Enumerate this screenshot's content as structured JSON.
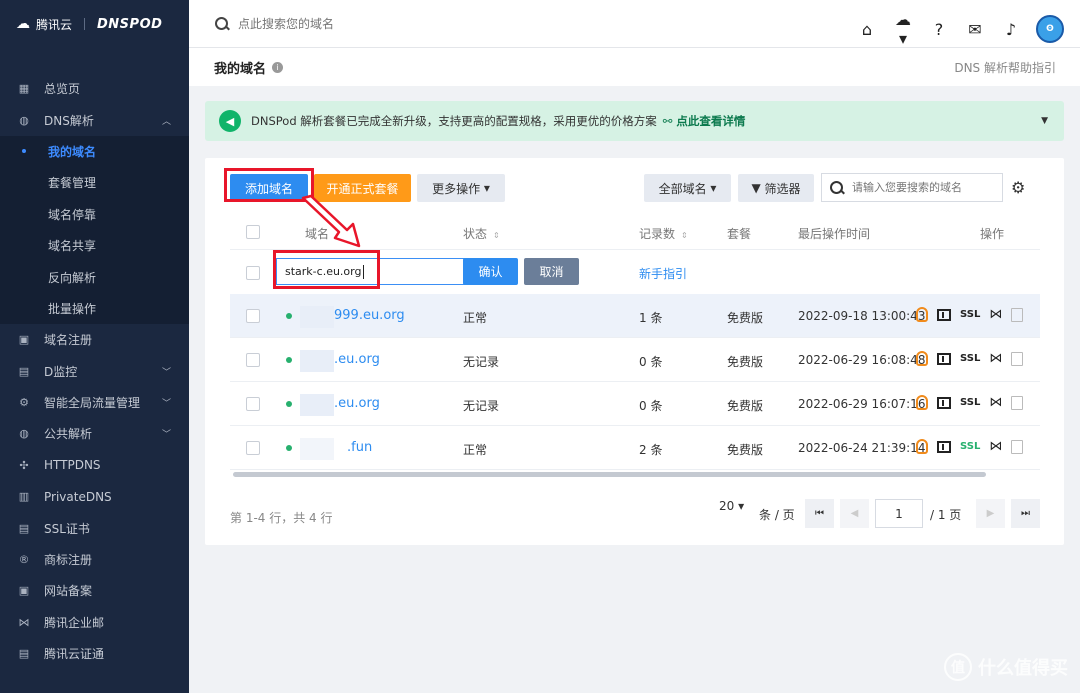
{
  "brand": {
    "cloud_name": "腾讯云",
    "product": "DNSPOD"
  },
  "sidebar": {
    "items": [
      {
        "label": "总览页",
        "icon": "dashboard-icon"
      },
      {
        "label": "DNS解析",
        "icon": "globe-icon",
        "expanded": true
      },
      {
        "label": "域名注册",
        "icon": "calendar-icon"
      },
      {
        "label": "D监控",
        "icon": "monitor-icon"
      },
      {
        "label": "智能全局流量管理",
        "icon": "traffic-icon"
      },
      {
        "label": "公共解析",
        "icon": "public-dns-icon"
      },
      {
        "label": "HTTPDNS",
        "icon": "httpdns-icon"
      },
      {
        "label": "PrivateDNS",
        "icon": "privatedns-icon"
      },
      {
        "label": "SSL证书",
        "icon": "ssl-icon"
      },
      {
        "label": "商标注册",
        "icon": "trademark-icon"
      },
      {
        "label": "网站备案",
        "icon": "filing-icon"
      },
      {
        "label": "腾讯企业邮",
        "icon": "mail-icon"
      },
      {
        "label": "腾讯云证通",
        "icon": "cert-icon"
      }
    ],
    "dns_sub": [
      "我的域名",
      "套餐管理",
      "域名停靠",
      "域名共享",
      "反向解析",
      "批量操作"
    ]
  },
  "topbar": {
    "search_placeholder": "点此搜索您的域名"
  },
  "page": {
    "title": "我的域名",
    "help_link": "DNS 解析帮助指引"
  },
  "notice": {
    "text": "DNSPod 解析套餐已完成全新升级，支持更高的配置规格，采用更优的价格方案",
    "link": "点此查看详情"
  },
  "toolbar": {
    "add_label": "添加域名",
    "package_label": "开通正式套餐",
    "more_label": "更多操作",
    "all_domains_label": "全部域名",
    "filter_label": "筛选器",
    "search_placeholder": "请输入您要搜索的域名"
  },
  "table": {
    "headers": {
      "domain": "域名",
      "status": "状态",
      "records": "记录数",
      "plan": "套餐",
      "last_op": "最后操作时间",
      "actions": "操作"
    },
    "add_row": {
      "input_value": "stark-c.eu.org",
      "confirm": "确认",
      "cancel": "取消",
      "guide": "新手指引"
    },
    "rows": [
      {
        "domain": "999.eu.org",
        "status": "正常",
        "records": "1 条",
        "plan": "免费版",
        "time": "2022-09-18 13:00:43",
        "ssl_green": false
      },
      {
        "domain": ".eu.org",
        "status": "无记录",
        "records": "0 条",
        "plan": "免费版",
        "time": "2022-06-29 16:08:48",
        "ssl_green": false
      },
      {
        "domain": ".eu.org",
        "status": "无记录",
        "records": "0 条",
        "plan": "免费版",
        "time": "2022-06-29 16:07:16",
        "ssl_green": false
      },
      {
        "domain": ".fun",
        "status": "正常",
        "records": "2 条",
        "plan": "免费版",
        "time": "2022-06-24 21:39:14",
        "ssl_green": true
      }
    ],
    "ssl_text": "SSL"
  },
  "footer": {
    "summary": "第 1-4 行，共 4 行",
    "page_size": "20",
    "per_page_label": "条 / 页",
    "current_page": "1",
    "total_pages": "/ 1 页"
  },
  "watermark": {
    "text": "什么值得买",
    "mark": "值"
  },
  "colors": {
    "primary": "#2d8cf0",
    "orange": "#ff9a18",
    "sidebar_bg": "#1b2840",
    "highlight": "#e8162a",
    "notice_bg": "#d6f2e4"
  }
}
